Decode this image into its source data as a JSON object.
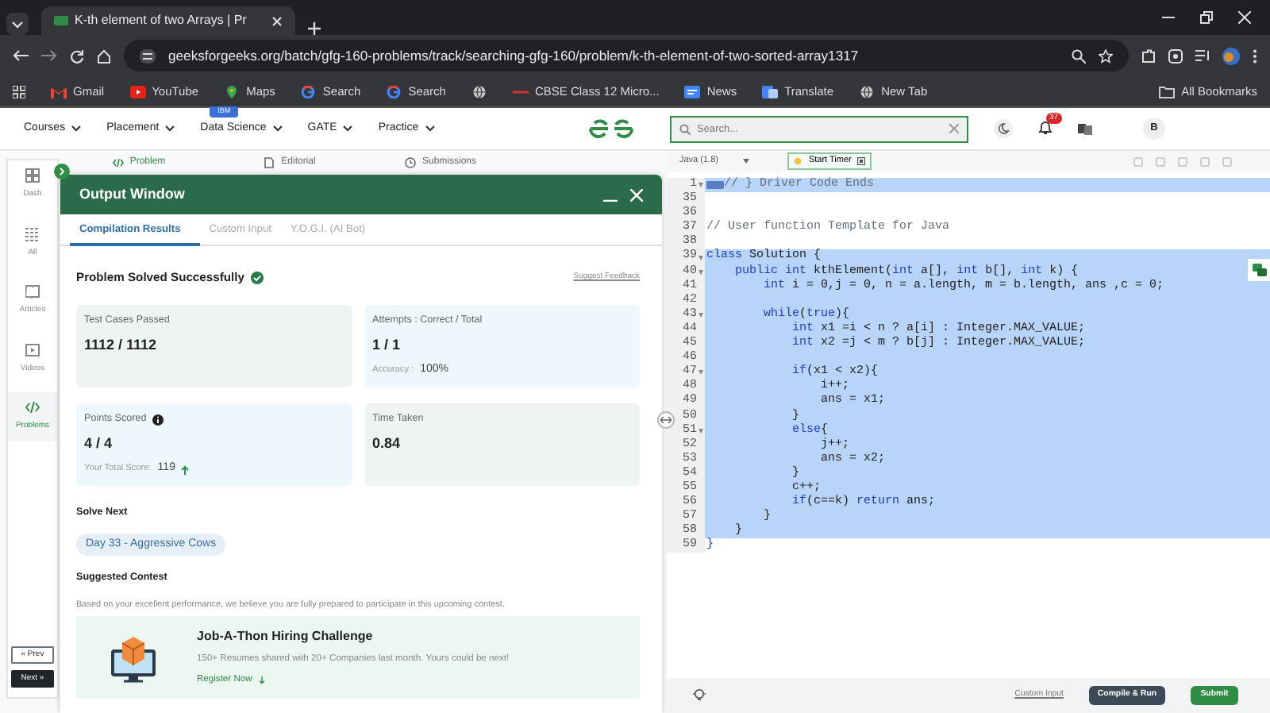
{
  "browser": {
    "tab_title": "K-th element of two Arrays | Pr",
    "url": "geeksforgeeks.org/batch/gfg-160-problems/track/searching-gfg-160/problem/k-th-element-of-two-sorted-array1317",
    "bookmarks": [
      {
        "kind": "gmail",
        "label": "Gmail"
      },
      {
        "kind": "youtube",
        "label": "YouTube"
      },
      {
        "kind": "maps",
        "label": "Maps"
      },
      {
        "kind": "google",
        "label": "Search"
      },
      {
        "kind": "google",
        "label": "Search"
      },
      {
        "kind": "globe"
      },
      {
        "kind": "cbse",
        "label": "CBSE Class 12 Micro..."
      },
      {
        "kind": "news",
        "label": "News"
      },
      {
        "kind": "translate",
        "label": "Translate"
      },
      {
        "kind": "globe",
        "label": "New Tab"
      }
    ],
    "all_bookmarks": "All Bookmarks"
  },
  "site": {
    "nav": [
      {
        "label": "Courses"
      },
      {
        "label": "Placement"
      },
      {
        "label": "Data Science",
        "badge": "IBM"
      },
      {
        "label": "GATE"
      },
      {
        "label": "Practice"
      }
    ],
    "search": {
      "placeholder": "Search..."
    },
    "notifications": "37",
    "avatar": "B"
  },
  "sidebar": {
    "items": [
      {
        "kind": "dash",
        "label": "Dash",
        "selected": false
      },
      {
        "kind": "all",
        "label": "All",
        "selected": false
      },
      {
        "kind": "articles",
        "label": "Articles",
        "selected": false
      },
      {
        "kind": "videos",
        "label": "Videos",
        "selected": false
      },
      {
        "kind": "problems",
        "label": "Problems",
        "selected": true
      }
    ],
    "pager": [
      {
        "label": "« Prev",
        "kind": "outline"
      },
      {
        "label": "Next »",
        "kind": "filled"
      }
    ]
  },
  "problem_tabs": [
    {
      "kind": "code",
      "label": "Problem",
      "selected": true
    },
    {
      "kind": "doc",
      "label": "Editorial",
      "selected": false
    },
    {
      "kind": "clock",
      "label": "Submissions",
      "selected": false
    }
  ],
  "output_window": {
    "title": "Output Window",
    "tabs": [
      {
        "label": "Compilation Results",
        "selected": true
      },
      {
        "label": "Custom Input",
        "selected": false
      },
      {
        "label": "Y.O.G.I. (AI Bot)",
        "selected": false
      }
    ],
    "status": "Problem Solved Successfully",
    "feedback": "Suggest Feedback",
    "cards": [
      {
        "label": "Test Cases Passed",
        "value": "1112 / 1112",
        "color": "#eff4f3"
      },
      {
        "label": "Attempts : Correct / Total",
        "value": "1 / 1",
        "note_label": "Accuracy :",
        "note_value": "100%",
        "color": "#edf8fd"
      },
      {
        "label": "Points Scored",
        "info": true,
        "value": "4 / 4",
        "note_label": "Your Total Score:",
        "note_value": "119",
        "trend_up": true,
        "color": "#edf8fd"
      },
      {
        "label": "Time Taken",
        "value": "0.84",
        "color": "#eff4f3"
      }
    ],
    "solve_next": {
      "heading": "Solve Next",
      "items": [
        "Day 33 - Aggressive Cows"
      ]
    },
    "contest": {
      "heading": "Suggested Contest",
      "intro": "Based on your excellent performance, we believe you are fully prepared to participate in this upcoming contest.",
      "title": "Job-A-Thon Hiring Challenge",
      "text": "150+ Resumes shared with 20+ Companies last month. Yours could be next!",
      "link": "Register Now"
    }
  },
  "editor": {
    "language": "Java (1.8)",
    "timer": "Start Timer",
    "lines": [
      {
        "number": "1",
        "fold": true,
        "selected": true,
        "folded": true,
        "tokens": [
          {
            "kind": "comment",
            "text": "// } Driver Code Ends"
          }
        ]
      },
      {
        "number": "35",
        "fold": false,
        "selected": false
      },
      {
        "number": "36",
        "fold": false,
        "selected": false
      },
      {
        "number": "37",
        "fold": false,
        "selected": false,
        "tokens": [
          {
            "kind": "comment",
            "text": "// User function Template for Java"
          }
        ]
      },
      {
        "number": "38",
        "fold": false,
        "selected": false
      },
      {
        "number": "39",
        "fold": true,
        "selected": true,
        "tokens": [
          {
            "kind": "keyword",
            "text": "class"
          },
          {
            "kind": "plain",
            "text": " Solution {"
          }
        ]
      },
      {
        "number": "40",
        "fold": true,
        "selected": true,
        "tokens": [
          {
            "kind": "keyword",
            "text": "    public int"
          },
          {
            "kind": "plain",
            "text": " kthElement("
          },
          {
            "kind": "keyword",
            "text": "int"
          },
          {
            "kind": "plain",
            "text": " a[], "
          },
          {
            "kind": "keyword",
            "text": "int"
          },
          {
            "kind": "plain",
            "text": " b[], "
          },
          {
            "kind": "keyword",
            "text": "int"
          },
          {
            "kind": "plain",
            "text": " k) {"
          }
        ]
      },
      {
        "number": "41",
        "fold": false,
        "selected": true,
        "tokens": [
          {
            "kind": "keyword",
            "text": "        int"
          },
          {
            "kind": "plain",
            "text": " i = 0,j = 0, n = a.length, m = b.length, ans ,c = 0;"
          }
        ]
      },
      {
        "number": "42",
        "fold": false,
        "selected": true
      },
      {
        "number": "43",
        "fold": true,
        "selected": true,
        "tokens": [
          {
            "kind": "keyword",
            "text": "        while"
          },
          {
            "kind": "plain",
            "text": "("
          },
          {
            "kind": "keyword",
            "text": "true"
          },
          {
            "kind": "plain",
            "text": "){"
          }
        ]
      },
      {
        "number": "44",
        "fold": false,
        "selected": true,
        "tokens": [
          {
            "kind": "keyword",
            "text": "            int"
          },
          {
            "kind": "plain",
            "text": " x1 =i < n ? a[i] : Integer.MAX_VALUE;"
          }
        ]
      },
      {
        "number": "45",
        "fold": false,
        "selected": true,
        "tokens": [
          {
            "kind": "keyword",
            "text": "            int"
          },
          {
            "kind": "plain",
            "text": " x2 =j < m ? b[j] : Integer.MAX_VALUE;"
          }
        ]
      },
      {
        "number": "46",
        "fold": false,
        "selected": true
      },
      {
        "number": "47",
        "fold": true,
        "selected": true,
        "tokens": [
          {
            "kind": "keyword",
            "text": "            if"
          },
          {
            "kind": "plain",
            "text": "(x1 < x2){"
          }
        ]
      },
      {
        "number": "48",
        "fold": false,
        "selected": true,
        "tokens": [
          {
            "kind": "plain",
            "text": "                i++;"
          }
        ]
      },
      {
        "number": "49",
        "fold": false,
        "selected": true,
        "tokens": [
          {
            "kind": "plain",
            "text": "                ans = x1;"
          }
        ]
      },
      {
        "number": "50",
        "fold": false,
        "selected": true,
        "tokens": [
          {
            "kind": "plain",
            "text": "            }"
          }
        ]
      },
      {
        "number": "51",
        "fold": true,
        "selected": true,
        "tokens": [
          {
            "kind": "keyword",
            "text": "            else"
          },
          {
            "kind": "plain",
            "text": "{"
          }
        ]
      },
      {
        "number": "52",
        "fold": false,
        "selected": true,
        "tokens": [
          {
            "kind": "plain",
            "text": "                j++;"
          }
        ]
      },
      {
        "number": "53",
        "fold": false,
        "selected": true,
        "tokens": [
          {
            "kind": "plain",
            "text": "                ans = x2;"
          }
        ]
      },
      {
        "number": "54",
        "fold": false,
        "selected": true,
        "tokens": [
          {
            "kind": "plain",
            "text": "            }"
          }
        ]
      },
      {
        "number": "55",
        "fold": false,
        "selected": true,
        "tokens": [
          {
            "kind": "plain",
            "text": "            c++;"
          }
        ]
      },
      {
        "number": "56",
        "fold": false,
        "selected": true,
        "tokens": [
          {
            "kind": "keyword",
            "text": "            if"
          },
          {
            "kind": "plain",
            "text": "(c==k) "
          },
          {
            "kind": "keyword",
            "text": "return"
          },
          {
            "kind": "plain",
            "text": " ans;"
          }
        ]
      },
      {
        "number": "57",
        "fold": false,
        "selected": true,
        "tokens": [
          {
            "kind": "plain",
            "text": "        }"
          }
        ]
      },
      {
        "number": "58",
        "fold": false,
        "selected": true,
        "tokens": [
          {
            "kind": "plain",
            "text": "    }"
          }
        ]
      },
      {
        "number": "59",
        "fold": false,
        "selected": false,
        "tokens": [
          {
            "kind": "keyword",
            "text": "}"
          }
        ]
      }
    ],
    "custom_input": "Custom Input",
    "run": "Compile & Run",
    "submit": "Submit"
  }
}
